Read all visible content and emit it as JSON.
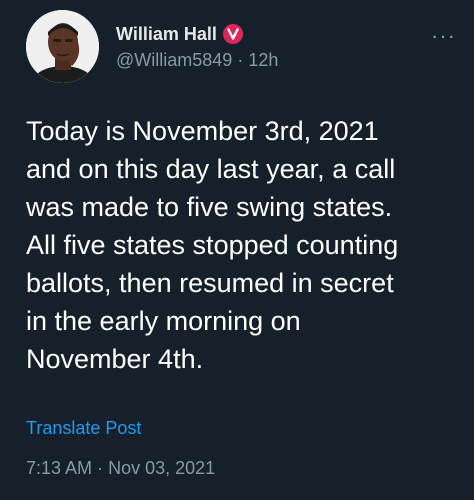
{
  "author": {
    "display_name": "William Hall",
    "handle": "@William5849",
    "separator": "·",
    "age": "12h",
    "avatar_icon": "avatar-photo",
    "verified_badge": "v-badge-icon",
    "badge_color": "#e0245e"
  },
  "menu": {
    "more_label": "···"
  },
  "post": {
    "text": "Today is November 3rd, 2021\nand on this day last year, a call\nwas made to five swing states.\nAll five states stopped counting\nballots, then resumed in secret\nin the early morning on\nNovember 4th."
  },
  "actions": {
    "translate_label": "Translate Post"
  },
  "meta": {
    "time": "7:13 AM",
    "separator": "·",
    "date": "Nov 03, 2021"
  },
  "colors": {
    "background": "#15202b",
    "text": "#ffffff",
    "secondary": "#8b98a5",
    "link": "#1d9bf0"
  }
}
